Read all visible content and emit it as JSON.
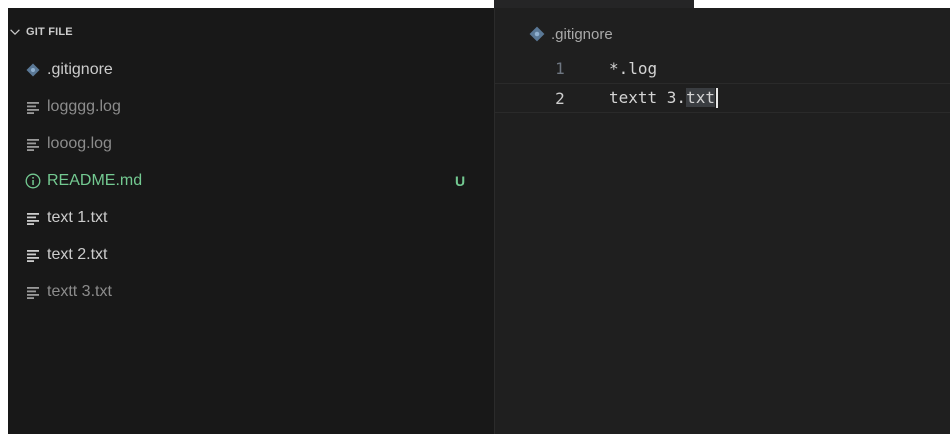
{
  "explorer": {
    "section_title": "GIT FILE",
    "files": [
      {
        "name": ".gitignore",
        "icon": "git-diamond-icon",
        "status": "normal",
        "badge": ""
      },
      {
        "name": "logggg.log",
        "icon": "lines-icon",
        "status": "ignored",
        "badge": ""
      },
      {
        "name": "looog.log",
        "icon": "lines-icon",
        "status": "ignored",
        "badge": ""
      },
      {
        "name": "README.md",
        "icon": "info-icon",
        "status": "untracked",
        "badge": "U"
      },
      {
        "name": "text 1.txt",
        "icon": "lines-icon",
        "status": "normal",
        "badge": ""
      },
      {
        "name": "text 2.txt",
        "icon": "lines-icon",
        "status": "normal",
        "badge": ""
      },
      {
        "name": "textt 3.txt",
        "icon": "lines-icon",
        "status": "ignored",
        "badge": ""
      }
    ]
  },
  "editor": {
    "breadcrumb": ".gitignore",
    "breadcrumb_icon": "git-diamond-icon",
    "lines": [
      {
        "number": "1",
        "prefix": "*.log",
        "selected": "",
        "active": false
      },
      {
        "number": "2",
        "prefix": "textt 3.",
        "selected": "txt",
        "active": true
      }
    ]
  },
  "colors": {
    "untracked": "#73c991",
    "ignored": "#8c8c8c",
    "normal": "#cccccc",
    "git_icon": "#6d8fb5"
  }
}
